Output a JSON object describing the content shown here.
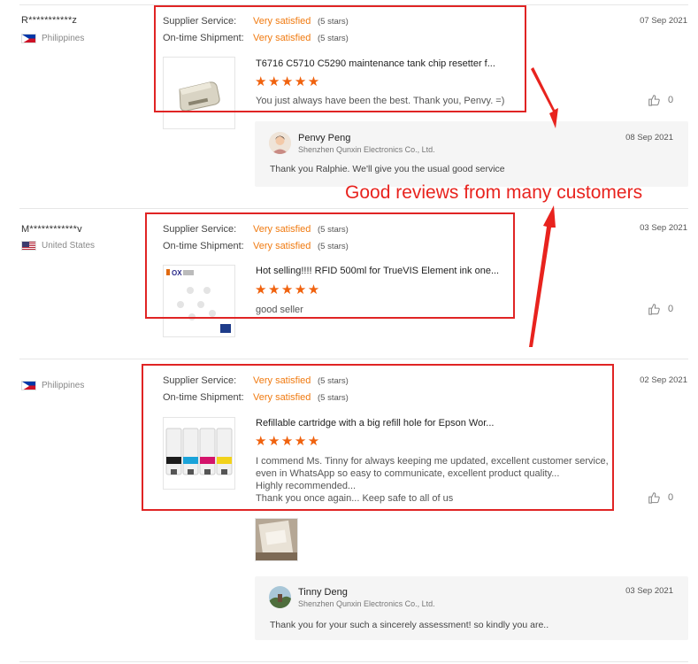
{
  "reviews": [
    {
      "buyer": "R***********z",
      "country": "Philippines",
      "date": "07 Sep 2021",
      "supplier_label": "Supplier Service:",
      "supplier_value": "Very satisfied",
      "supplier_stars": "(5 stars)",
      "shipment_label": "On-time Shipment:",
      "shipment_value": "Very satisfied",
      "shipment_stars": "(5 stars)",
      "product_title": "T6716 C5710 C5290 maintenance tank chip resetter f...",
      "stars": "★★★★★",
      "text": "You just always have been the best. Thank you, Penvy. =)",
      "likes": "0",
      "reply": {
        "name": "Penvy Peng",
        "company": "Shenzhen Qunxin Electronics Co., Ltd.",
        "date": "08 Sep 2021",
        "text": "Thank you Ralphie. We'll give you the usual good service"
      }
    },
    {
      "buyer": "M************v",
      "country": "United States",
      "date": "03 Sep 2021",
      "supplier_label": "Supplier Service:",
      "supplier_value": "Very satisfied",
      "supplier_stars": "(5 stars)",
      "shipment_label": "On-time Shipment:",
      "shipment_value": "Very satisfied",
      "shipment_stars": "(5 stars)",
      "product_title": "Hot selling!!!! RFID 500ml for TrueVIS Element ink one...",
      "stars": "★★★★★",
      "text": "good seller",
      "likes": "0",
      "thumb_brand": "OX"
    },
    {
      "buyer": "",
      "country": "Philippines",
      "date": "02 Sep 2021",
      "supplier_label": "Supplier Service:",
      "supplier_value": "Very satisfied",
      "supplier_stars": "(5 stars)",
      "shipment_label": "On-time Shipment:",
      "shipment_value": "Very satisfied",
      "shipment_stars": "(5 stars)",
      "product_title": "Refillable cartridge with a big refill hole for Epson Wor...",
      "stars": "★★★★★",
      "text_lines": [
        "I commend Ms. Tinny for always keeping me updated, excellent customer service,",
        "even in WhatsApp so easy to communicate, excellent product quality...",
        "Highly recommended...",
        "Thank you once again... Keep safe to all of us"
      ],
      "likes": "0",
      "reply": {
        "name": "Tinny Deng",
        "company": "Shenzhen Qunxin Electronics Co., Ltd.",
        "date": "03 Sep 2021",
        "text": "Thank you for your such a sincerely assessment!  so kindly you are.."
      }
    }
  ],
  "annotation": "Good reviews from many customers",
  "colors": {
    "accent": "#f07a10",
    "star": "#f0620e",
    "highlight": "#e02424"
  },
  "icons": {
    "like": "thumbs-up-icon"
  }
}
